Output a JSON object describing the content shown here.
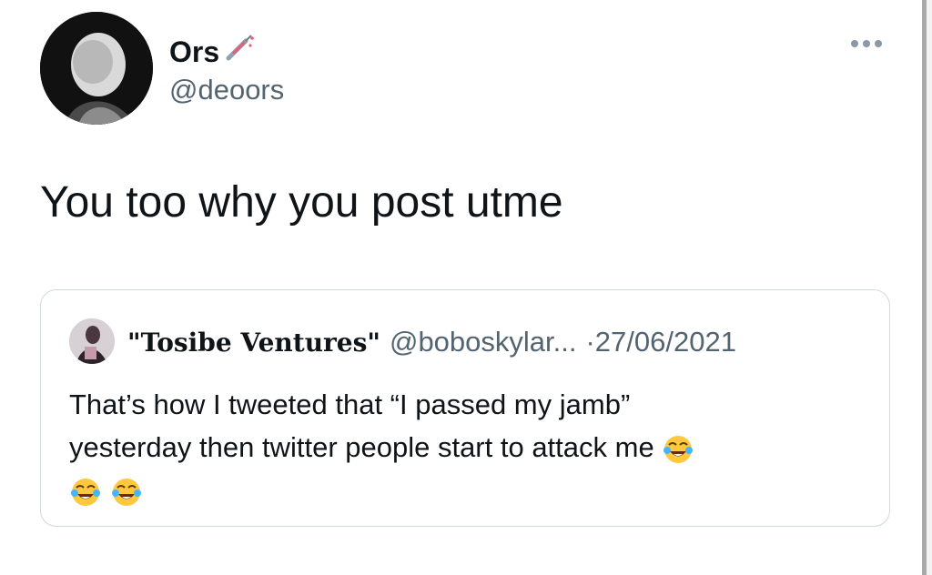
{
  "tweet": {
    "display_name": "Ors",
    "username": "@deoors",
    "text": "You too why you post utme"
  },
  "quoted_tweet": {
    "display_name": "\"Tosibe Ventures\"",
    "username": "@boboskylar...",
    "date": "·27/06/2021",
    "text_line_1": "That’s how I tweeted that “I passed my jamb”",
    "text_line_2": "yesterday then twitter people start to attack me"
  },
  "icons": {
    "author_badge": "syringe-icon",
    "more": "more-options-icon",
    "emoji": "tears-of-joy-emoji"
  }
}
